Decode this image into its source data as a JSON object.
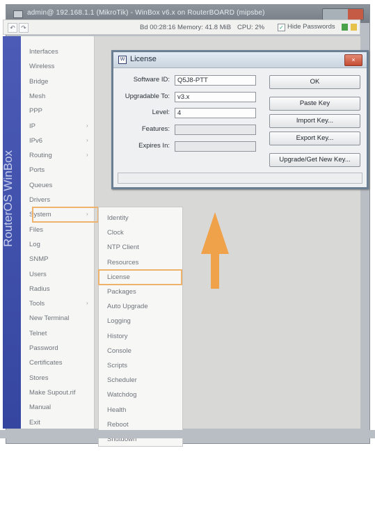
{
  "window": {
    "title": "admin@ 192.168.1.1 (MikroTik) - WinBox v6.x on RouterBOARD (mipsbe)"
  },
  "toolbar": {
    "undo": "↶",
    "redo": "↷",
    "uptime": "Bd 00:28:16",
    "memory": "Memory: 41.8 MiB",
    "cpu": "CPU: 2%",
    "hide_passwords": "Hide Passwords",
    "colors": {
      "green": "#4aa34a",
      "yellow": "#e6c24a"
    }
  },
  "brand": {
    "text": "RouterOS WinBox"
  },
  "menu": {
    "items": [
      {
        "label": "Interfaces",
        "arrow": ""
      },
      {
        "label": "Wireless",
        "arrow": ""
      },
      {
        "label": "Bridge",
        "arrow": ""
      },
      {
        "label": "Mesh",
        "arrow": ""
      },
      {
        "label": "PPP",
        "arrow": ""
      },
      {
        "label": "IP",
        "arrow": "›"
      },
      {
        "label": "IPv6",
        "arrow": "›"
      },
      {
        "label": "Routing",
        "arrow": "›"
      },
      {
        "label": "Ports",
        "arrow": ""
      },
      {
        "label": "Queues",
        "arrow": ""
      },
      {
        "label": "Drivers",
        "arrow": ""
      },
      {
        "label": "System",
        "arrow": "›"
      },
      {
        "label": "Files",
        "arrow": ""
      },
      {
        "label": "Log",
        "arrow": ""
      },
      {
        "label": "SNMP",
        "arrow": ""
      },
      {
        "label": "Users",
        "arrow": ""
      },
      {
        "label": "Radius",
        "arrow": ""
      },
      {
        "label": "Tools",
        "arrow": "›"
      },
      {
        "label": "New Terminal",
        "arrow": ""
      },
      {
        "label": "Telnet",
        "arrow": ""
      },
      {
        "label": "Password",
        "arrow": ""
      },
      {
        "label": "Certificates",
        "arrow": ""
      },
      {
        "label": "Stores",
        "arrow": ""
      },
      {
        "label": "Make Supout.rif",
        "arrow": ""
      },
      {
        "label": "Manual",
        "arrow": ""
      },
      {
        "label": "Exit",
        "arrow": ""
      }
    ]
  },
  "submenu": {
    "items": [
      "Identity",
      "Clock",
      "NTP Client",
      "Resources",
      "License",
      "Packages",
      "Auto Upgrade",
      "Logging",
      "History",
      "Console",
      "Scripts",
      "Scheduler",
      "Watchdog",
      "Health",
      "Reboot",
      "Shutdown"
    ]
  },
  "dialog": {
    "title": "License",
    "close": "×",
    "icon": "W",
    "fields": [
      {
        "label": "Software ID:",
        "value": "Q5J8-PTT"
      },
      {
        "label": "Upgradable To:",
        "value": "v3.x"
      },
      {
        "label": "Level:",
        "value": "4"
      },
      {
        "label": "Features:",
        "value": ""
      },
      {
        "label": "Expires In:",
        "value": ""
      }
    ],
    "buttons": {
      "ok": "OK",
      "paste_key": "Paste Key",
      "import_key": "Import Key...",
      "export_key": "Export Key...",
      "upgrade": "Upgrade/Get New Key..."
    }
  },
  "annotation": {
    "arrow_color": "#f0a24a",
    "highlight_color": "#efb26a"
  }
}
